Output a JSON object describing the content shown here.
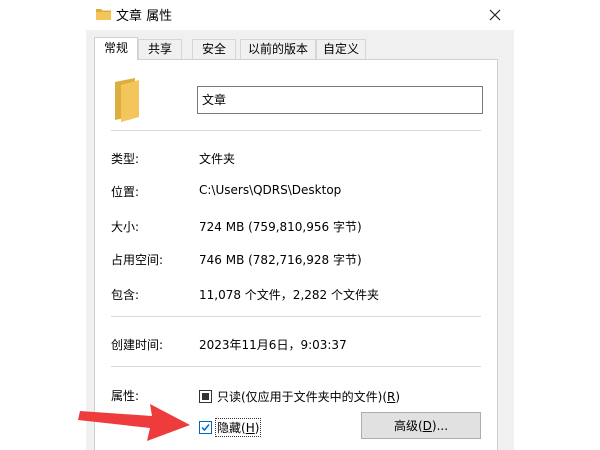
{
  "window": {
    "title": "文章 属性"
  },
  "tabs": [
    {
      "label": "常规"
    },
    {
      "label": "共享"
    },
    {
      "label": "安全"
    },
    {
      "label": "以前的版本"
    },
    {
      "label": "自定义"
    }
  ],
  "general": {
    "name_value": "文章",
    "type_label": "类型:",
    "type_value": "文件夹",
    "location_label": "位置:",
    "location_value": "C:\\Users\\QDRS\\Desktop",
    "size_label": "大小:",
    "size_value": "724 MB (759,810,956 字节)",
    "disk_size_label": "占用空间:",
    "disk_size_value": "746 MB (782,716,928 字节)",
    "contains_label": "包含:",
    "contains_value": "11,078 个文件，2,282 个文件夹",
    "created_label": "创建时间:",
    "created_value": "2023年11月6日，9:03:37",
    "attributes_label": "属性:",
    "readonly_label": "只读(仅应用于文件夹中的文件)(",
    "readonly_key": "R",
    "readonly_tail": ")",
    "hidden_label": "隐藏(",
    "hidden_key": "H",
    "hidden_tail": ")",
    "advanced_label": "高级(",
    "advanced_key": "D",
    "advanced_tail": ")..."
  },
  "colors": {
    "folder": "#f4c55a",
    "arrow": "#ee3b3b",
    "accent": "#0067c0"
  },
  "icons": {
    "folder": "folder-icon",
    "close": "close-icon",
    "arrow": "red-arrow-annotation"
  }
}
